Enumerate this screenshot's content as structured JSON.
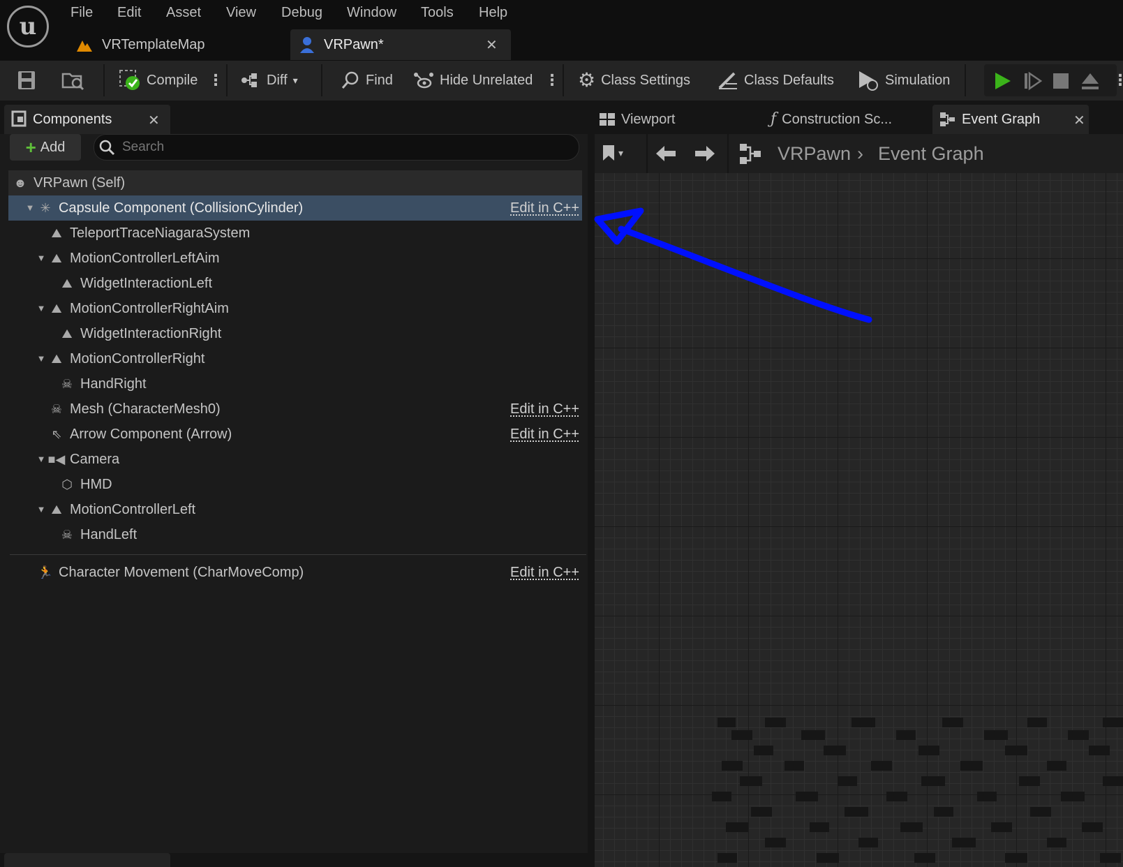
{
  "menu": [
    "File",
    "Edit",
    "Asset",
    "View",
    "Debug",
    "Window",
    "Tools",
    "Help"
  ],
  "doc_tabs": [
    {
      "label": "VRTemplateMap"
    },
    {
      "label": "VRPawn*"
    }
  ],
  "toolbar": {
    "compile": "Compile",
    "diff": "Diff",
    "find": "Find",
    "hide_unrelated": "Hide Unrelated",
    "class_settings": "Class Settings",
    "class_defaults": "Class Defaults",
    "simulation": "Simulation"
  },
  "components": {
    "tab_label": "Components",
    "add_label": "Add",
    "search_placeholder": "Search",
    "edit_cpp": "Edit in C++",
    "tree": [
      {
        "label": "VRPawn (Self)"
      },
      {
        "label": "Capsule Component (CollisionCylinder)"
      },
      {
        "label": "TeleportTraceNiagaraSystem"
      },
      {
        "label": "MotionControllerLeftAim"
      },
      {
        "label": "WidgetInteractionLeft"
      },
      {
        "label": "MotionControllerRightAim"
      },
      {
        "label": "WidgetInteractionRight"
      },
      {
        "label": "MotionControllerRight"
      },
      {
        "label": "HandRight"
      },
      {
        "label": "Mesh (CharacterMesh0)"
      },
      {
        "label": "Arrow Component (Arrow)"
      },
      {
        "label": "Camera"
      },
      {
        "label": "HMD"
      },
      {
        "label": "MotionControllerLeft"
      },
      {
        "label": "HandLeft"
      }
    ],
    "movement": "Character Movement (CharMoveComp)"
  },
  "graph_tabs": [
    "Viewport",
    "Construction Sc...",
    "Event Graph"
  ],
  "breadcrumb": {
    "root": "VRPawn",
    "current": "Event Graph"
  },
  "colors": {
    "accent_selection": "#3b4e63",
    "annotation_arrow": "#0010ff",
    "play_green": "#3bb31a"
  }
}
